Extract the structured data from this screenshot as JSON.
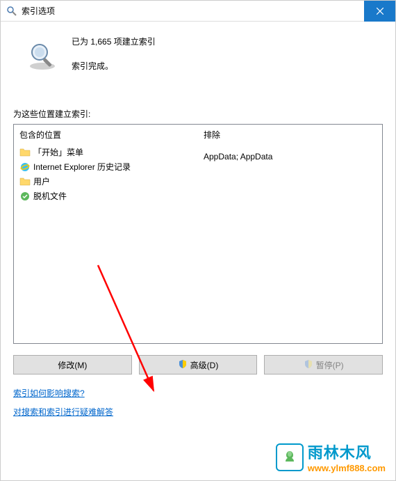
{
  "titlebar": {
    "title": "索引选项"
  },
  "status": {
    "line1": "已为 1,665 项建立索引",
    "line2": "索引完成。"
  },
  "section_label": "为这些位置建立索引:",
  "columns": {
    "included_header": "包含的位置",
    "excluded_header": "排除"
  },
  "included_items": [
    {
      "icon": "folder",
      "label": "「开始」菜单"
    },
    {
      "icon": "ie",
      "label": "Internet Explorer 历史记录"
    },
    {
      "icon": "folder",
      "label": "用户"
    },
    {
      "icon": "offline",
      "label": "脱机文件"
    }
  ],
  "excluded_rows": [
    "",
    "",
    "AppData; AppData",
    ""
  ],
  "buttons": {
    "modify": "修改(M)",
    "advanced": "高级(D)",
    "pause": "暂停(P)"
  },
  "links": {
    "how_affects": "索引如何影响搜索?",
    "troubleshoot": "对搜索和索引进行疑难解答"
  },
  "watermark": {
    "cn": "雨林木风",
    "url": "www.ylmf888.com"
  }
}
